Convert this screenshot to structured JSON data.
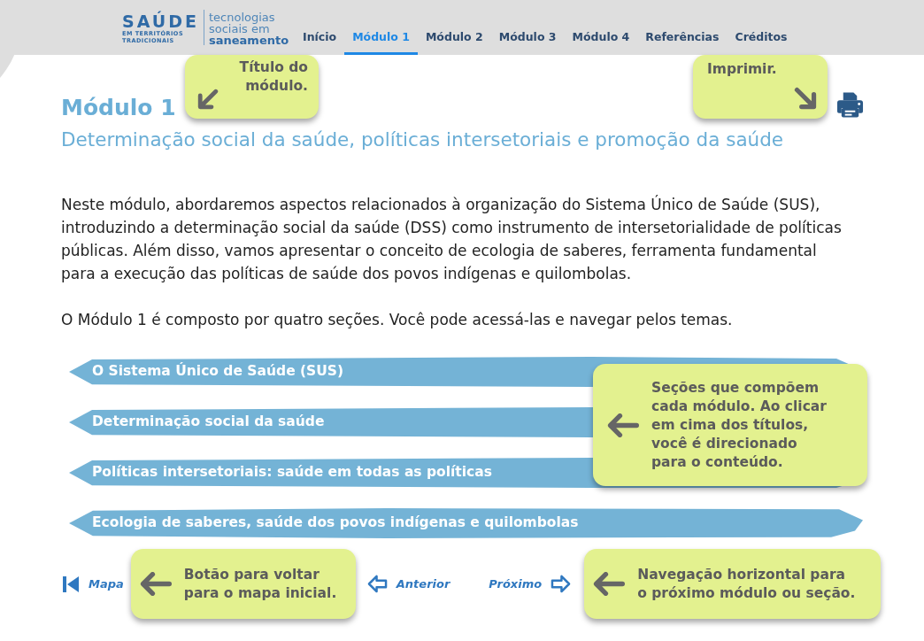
{
  "header": {
    "logo": {
      "wordmark": "SAÚDE",
      "tagline": [
        "EM TERRITÓRIOS",
        "TRADICIONAIS"
      ],
      "product": [
        "tecnologias",
        "sociais em",
        "saneamento"
      ]
    },
    "nav": [
      {
        "label": "Início",
        "selected": false
      },
      {
        "label": "Módulo 1",
        "selected": true
      },
      {
        "label": "Módulo 2",
        "selected": false
      },
      {
        "label": "Módulo 3",
        "selected": false
      },
      {
        "label": "Módulo 4",
        "selected": false
      },
      {
        "label": "Referências",
        "selected": false
      },
      {
        "label": "Créditos",
        "selected": false
      }
    ]
  },
  "page_header": {
    "title": "Módulo 1",
    "subtitle": "Determinação social da saúde, políticas intersetoriais e promoção da saúde",
    "title_callout": "Título do módulo.",
    "print_callout": "Imprimir."
  },
  "intro": [
    "Neste módulo, abordaremos aspectos relacionados à organização do Sistema Único de Saúde (SUS), introduzindo a determinação social da saúde (DSS) como instrumento de intersetorialidade de políticas públicas. Além disso, vamos apresentar o conceito de ecologia de saberes, ferramenta fundamental para a execução das políticas de saúde dos povos indígenas e quilombolas.",
    "O Módulo 1 é composto por quatro seções. Você pode acessá-las e navegar pelos temas."
  ],
  "sections": {
    "items": [
      {
        "label": "O Sistema Único de Saúde (SUS)"
      },
      {
        "label": "Determinação social da saúde"
      },
      {
        "label": "Políticas intersetoriais: saúde em todas as políticas"
      },
      {
        "label": "Ecologia de saberes, saúde dos povos indígenas e quilombolas"
      }
    ],
    "callout": "Seções que compõem cada módulo. Ao clicar em cima dos títulos, você é direcionado para o conteúdo."
  },
  "footer_nav": {
    "map": "Mapa",
    "map_callout": "Botão para voltar para o mapa inicial.",
    "previous": "Anterior",
    "next": "Próximo",
    "next_callout": "Navegação horizontal para o próximo módulo ou seção."
  }
}
